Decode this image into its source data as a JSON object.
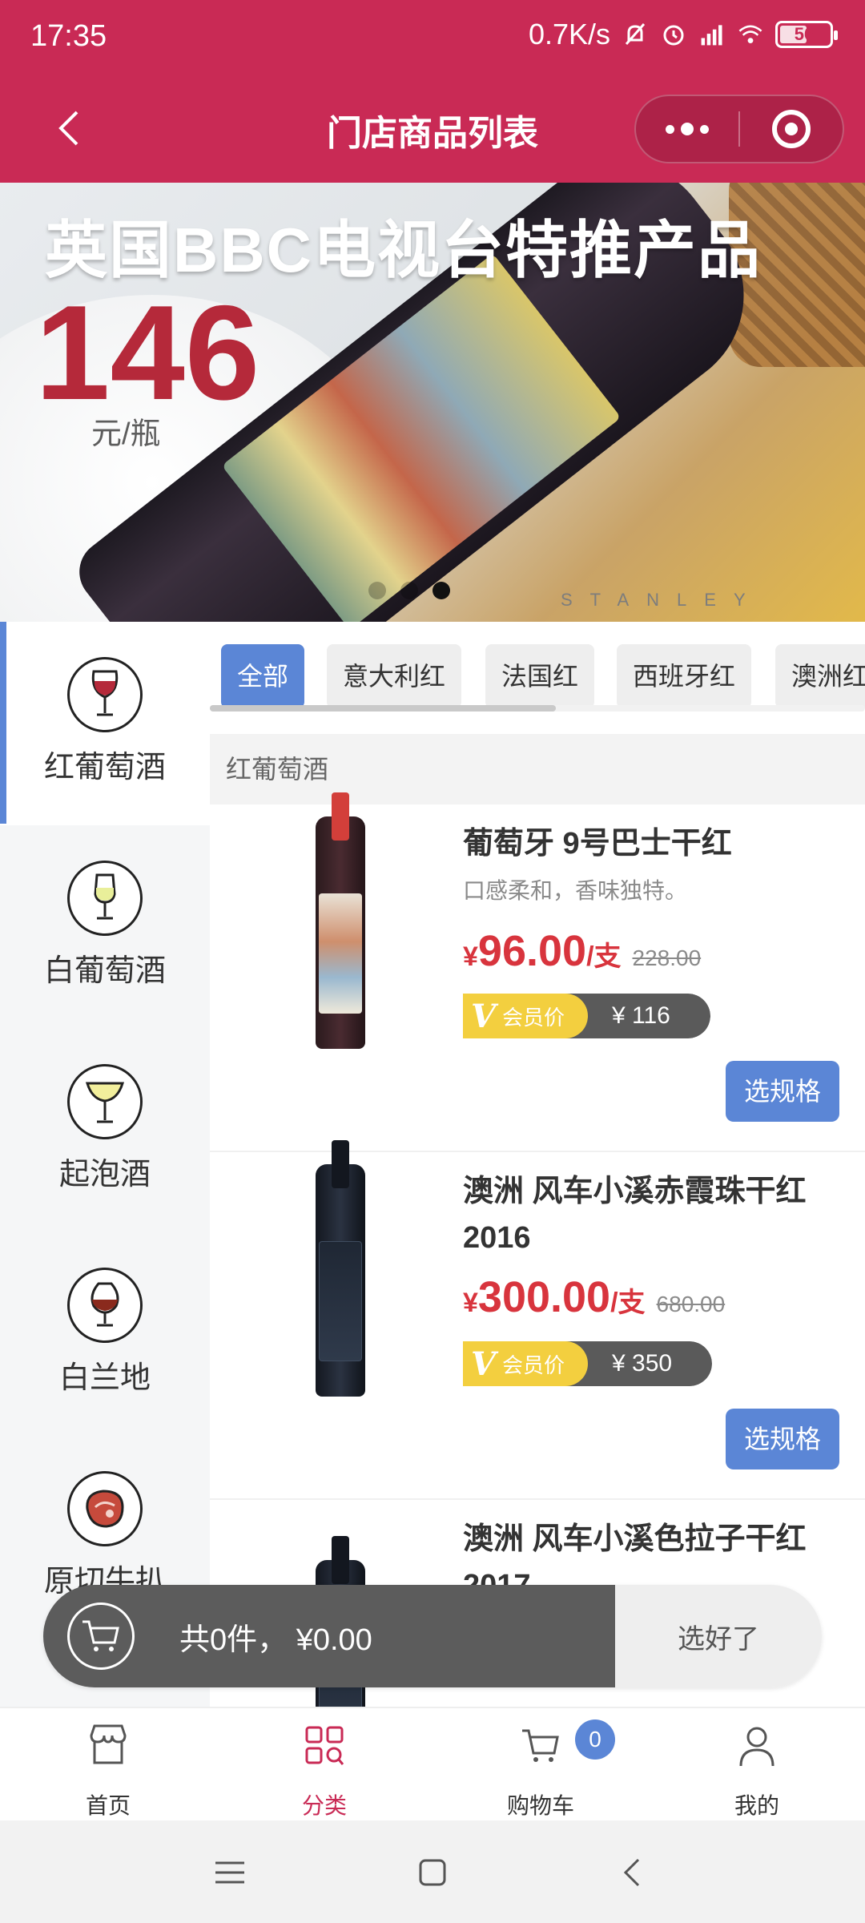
{
  "status_bar": {
    "time": "17:35",
    "network_speed": "0.7K/s",
    "battery": "56",
    "icons": [
      "mute-icon",
      "alarm-icon",
      "hd-signal-icon",
      "wifi-icon",
      "battery-icon"
    ]
  },
  "header": {
    "title": "门店商品列表",
    "back_icon": "back-arrow-icon",
    "menu_icon": "more-dots-icon",
    "close_icon": "target-circle-icon",
    "bg_color": "#c92a55"
  },
  "banner": {
    "title": "英国BBC电视台特推产品",
    "price": "146",
    "unit": "元/瓶",
    "brand": "STANLEY",
    "dots_total": 3,
    "active_dot": 2
  },
  "sidebar": {
    "items": [
      {
        "label": "红葡萄酒",
        "icon": "red-wine-glass-icon",
        "active": true
      },
      {
        "label": "白葡萄酒",
        "icon": "white-wine-glass-icon",
        "active": false
      },
      {
        "label": "起泡酒",
        "icon": "sparkling-glass-icon",
        "active": false
      },
      {
        "label": "白兰地",
        "icon": "brandy-glass-icon",
        "active": false
      },
      {
        "label": "原切牛扒",
        "icon": "steak-icon",
        "active": false
      }
    ]
  },
  "tabs": [
    "全部",
    "意大利红",
    "法国红",
    "西班牙红",
    "澳洲红"
  ],
  "active_tab": "全部",
  "subhead": "红葡萄酒",
  "products": [
    {
      "name": "葡萄牙 9号巴士干红",
      "desc": "口感柔和，香味独特。",
      "currency": "¥",
      "price": "96.00",
      "unit": "/支",
      "orig_price": "228.00",
      "vip_label": "会员价",
      "vip_price": "¥ 116",
      "button": "选规格"
    },
    {
      "name": "澳洲 风车小溪赤霞珠干红 2016",
      "desc": "",
      "currency": "¥",
      "price": "300.00",
      "unit": "/支",
      "orig_price": "680.00",
      "vip_label": "会员价",
      "vip_price": "¥ 350",
      "button": "选规格"
    },
    {
      "name": "澳洲 风车小溪色拉子干红 2017"
    }
  ],
  "cart_bar": {
    "summary": "共0件， ¥0.00",
    "confirm": "选好了",
    "icon": "cart-icon"
  },
  "tabbar": {
    "items": [
      {
        "label": "首页",
        "icon": "store-icon"
      },
      {
        "label": "分类",
        "icon": "category-grid-icon",
        "active": true
      },
      {
        "label": "购物车",
        "icon": "cart-icon",
        "badge": "0"
      },
      {
        "label": "我的",
        "icon": "user-icon"
      }
    ],
    "active_color": "#c92a55",
    "badge_color": "#5b86d6"
  },
  "system_nav": [
    "menu-icon",
    "home-icon",
    "back-icon"
  ]
}
